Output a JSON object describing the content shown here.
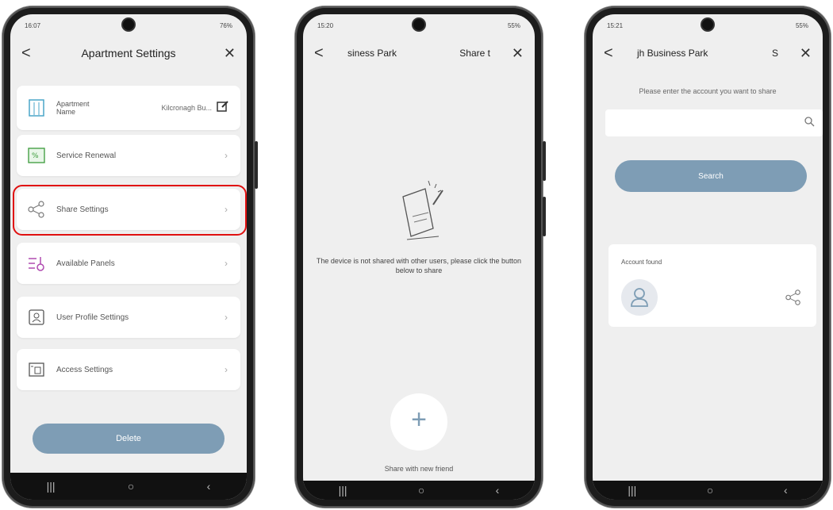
{
  "phone1": {
    "status_time": "16:07",
    "status_right": "76%",
    "title": "Apartment Settings",
    "back_glyph": "<",
    "close_glyph": "✕",
    "apartment_name_label": "Apartment Name",
    "apartment_name_value": "Kilcronagh Bu...",
    "items": [
      {
        "label": "Service Renewal",
        "icon": "percent-ticket-icon"
      },
      {
        "label": "Share Settings",
        "icon": "share-icon"
      },
      {
        "label": "Available Panels",
        "icon": "panels-icon"
      },
      {
        "label": "User Profile Settings",
        "icon": "user-card-icon"
      },
      {
        "label": "Access Settings",
        "icon": "access-icon"
      }
    ],
    "delete_label": "Delete",
    "highlight_color": "#e01010"
  },
  "phone2": {
    "status_time": "15:20",
    "status_right": "55%",
    "title_left": "siness Park",
    "title_right": "Share t",
    "empty_message": "The device is not shared with other users, please click the button below to share",
    "add_label": "Share with new friend"
  },
  "phone3": {
    "status_time": "15:21",
    "status_right": "55%",
    "title_left": "jh Business Park",
    "title_right": "S",
    "prompt": "Please enter the account you want to share",
    "search_placeholder": "",
    "search_button": "Search",
    "account_found": "Account found"
  },
  "colors": {
    "accent": "#7e9db5",
    "background": "#efefef"
  }
}
